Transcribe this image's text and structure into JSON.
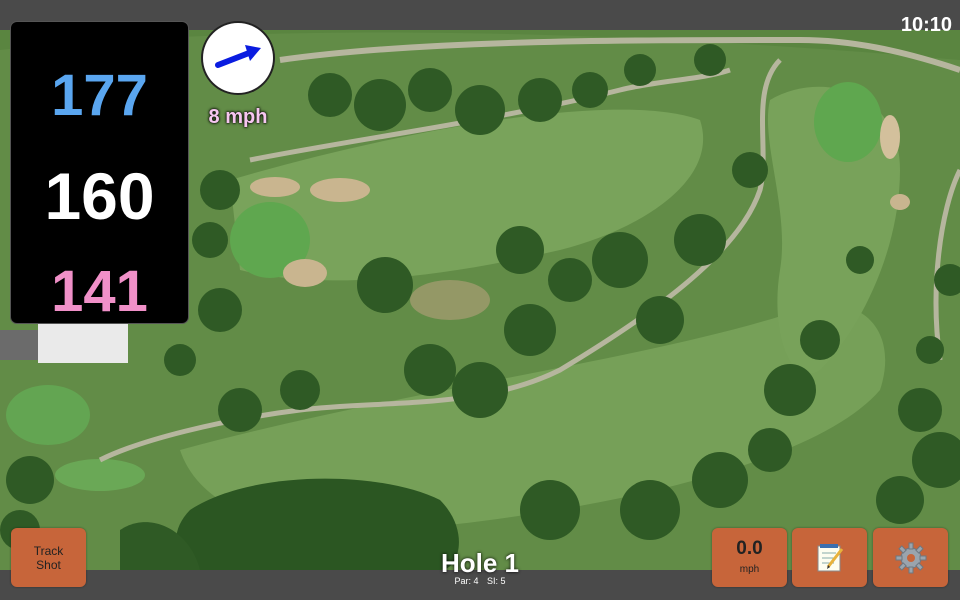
{
  "status": {
    "time": "10:10"
  },
  "yardages": {
    "back": "177",
    "middle": "160",
    "front": "141"
  },
  "wind": {
    "speed_label": "8 mph",
    "direction_icon": "arrow-icon",
    "readout_value": "0.0",
    "readout_unit": "mph"
  },
  "hole": {
    "title": "Hole 1",
    "par": "Par: 4",
    "si": "SI: 5"
  },
  "buttons": {
    "track_shot_line1": "Track",
    "track_shot_line2": "Shot",
    "notes_icon": "notepad-icon",
    "settings_icon": "gear-icon"
  },
  "colors": {
    "back": "#5aa6f0",
    "middle": "#ffffff",
    "front": "#f090c8",
    "button": "#c7653a",
    "wind_label": "#f6c6f0"
  }
}
